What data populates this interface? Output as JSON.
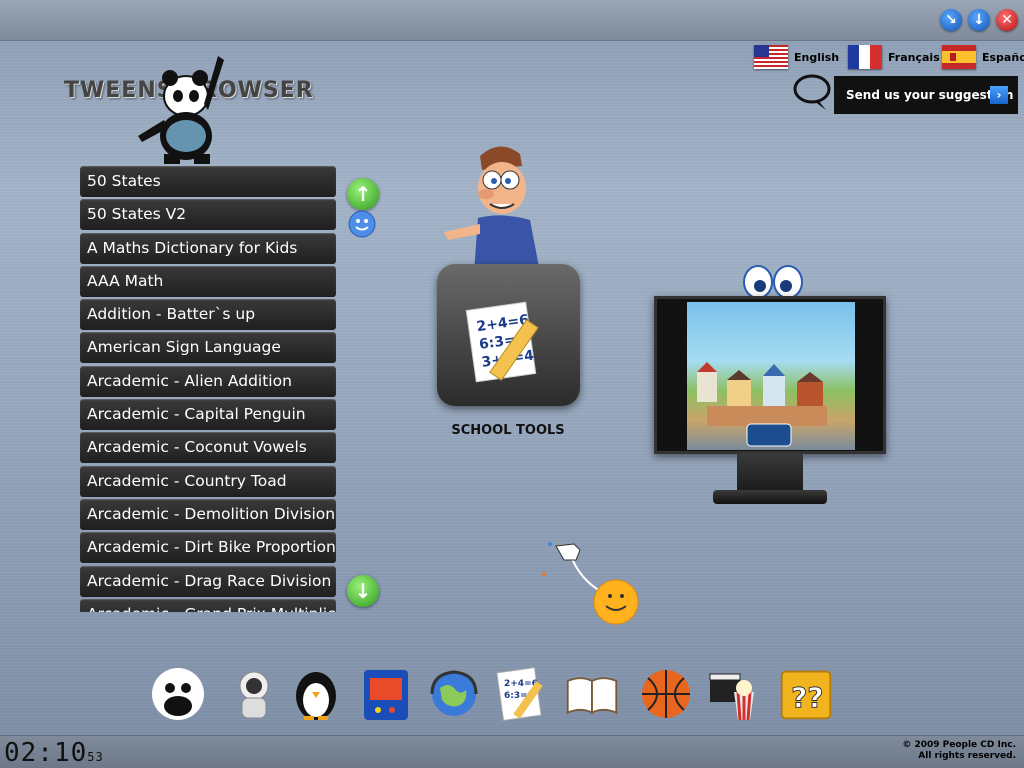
{
  "window_controls": [
    "minimize",
    "maximize",
    "close"
  ],
  "languages": [
    {
      "label": "English",
      "flag": "us-flag"
    },
    {
      "label": "Français",
      "flag": "fr-flag"
    },
    {
      "label": "Español",
      "flag": "es-flag"
    }
  ],
  "suggestion": {
    "label": "Send us your suggestion"
  },
  "logo": {
    "text": "TWEENS BROWSER"
  },
  "app_list": [
    "50 States",
    "50 States V2",
    "A Maths Dictionary for Kids",
    "AAA Math",
    "Addition - Batter`s up",
    "American Sign Language",
    "Arcademic - Alien Addition",
    "Arcademic - Capital Penguin",
    "Arcademic - Coconut Vowels",
    "Arcademic - Country Toad",
    "Arcademic - Demolition Division",
    "Arcademic - Dirt Bike Proportions",
    "Arcademic - Drag Race Division",
    "Arcademic - Grand Prix Multiplication"
  ],
  "school_tools": {
    "label": "SCHOOL TOOLS"
  },
  "clock": {
    "main": "02:10",
    "seconds": "53"
  },
  "copyright": {
    "line1": "© 2009 People CD Inc.",
    "line2": "All rights reserved."
  },
  "dock": [
    "panda-icon",
    "astronaut-icon",
    "penguin-icon",
    "arcade-icon",
    "globe-icon",
    "school-tools-icon",
    "book-icon",
    "basketball-icon",
    "movie-icon",
    "mystery-box-icon"
  ],
  "colors": {
    "accent": "#1664c8",
    "list_bg": "#2a2a2a",
    "scroll_green": "#2e9a1d"
  }
}
